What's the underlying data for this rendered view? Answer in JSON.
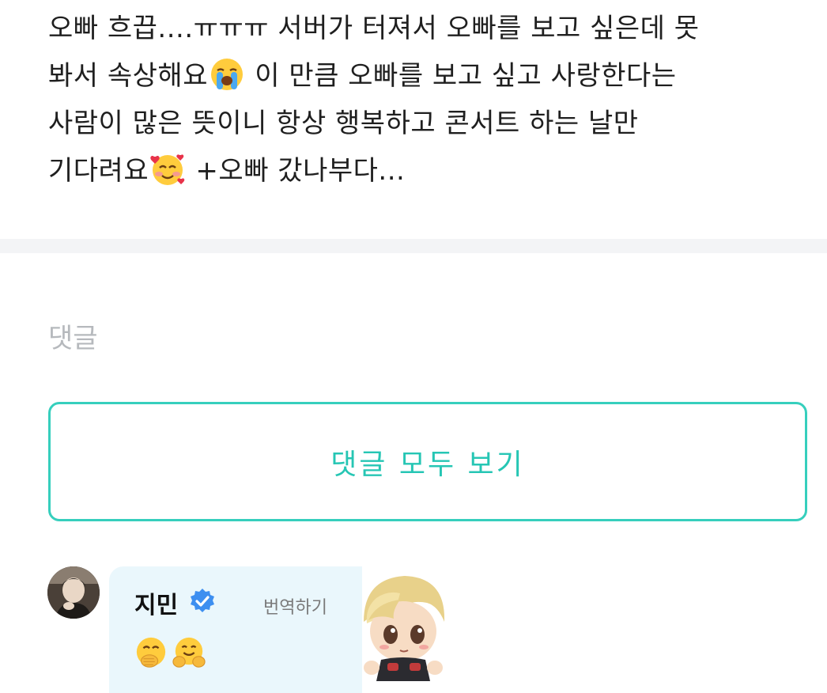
{
  "post": {
    "line1": "오빠 흐끕....ㅠㅠㅠ 서버가 터져서 오빠를 보고 싶은데 못",
    "line2_a": "봐서 속상해요",
    "line2_b": " 이 만큼 오빠를 보고 싶고 사랑한다는",
    "line3": "사람이 많은 뜻이니 항상 행복하고 콘서트 하는 날만",
    "line4_a": "기다려요",
    "line4_b": " +오빠 갔나부다...",
    "emojis": [
      "loudly-crying-face",
      "smiling-face-with-hearts"
    ]
  },
  "comments": {
    "heading": "댓글",
    "view_all_label": "댓글 모두 보기",
    "accent_color": "#26c6b4"
  },
  "reply": {
    "name": "지민",
    "verified_icon": "verified-badge-icon",
    "translate_label": "번역하기",
    "emojis": [
      "face-with-hand-over-mouth",
      "hugging-face"
    ],
    "bubble_color": "#eaf7fc",
    "sticker": "chibi-character-sticker"
  }
}
